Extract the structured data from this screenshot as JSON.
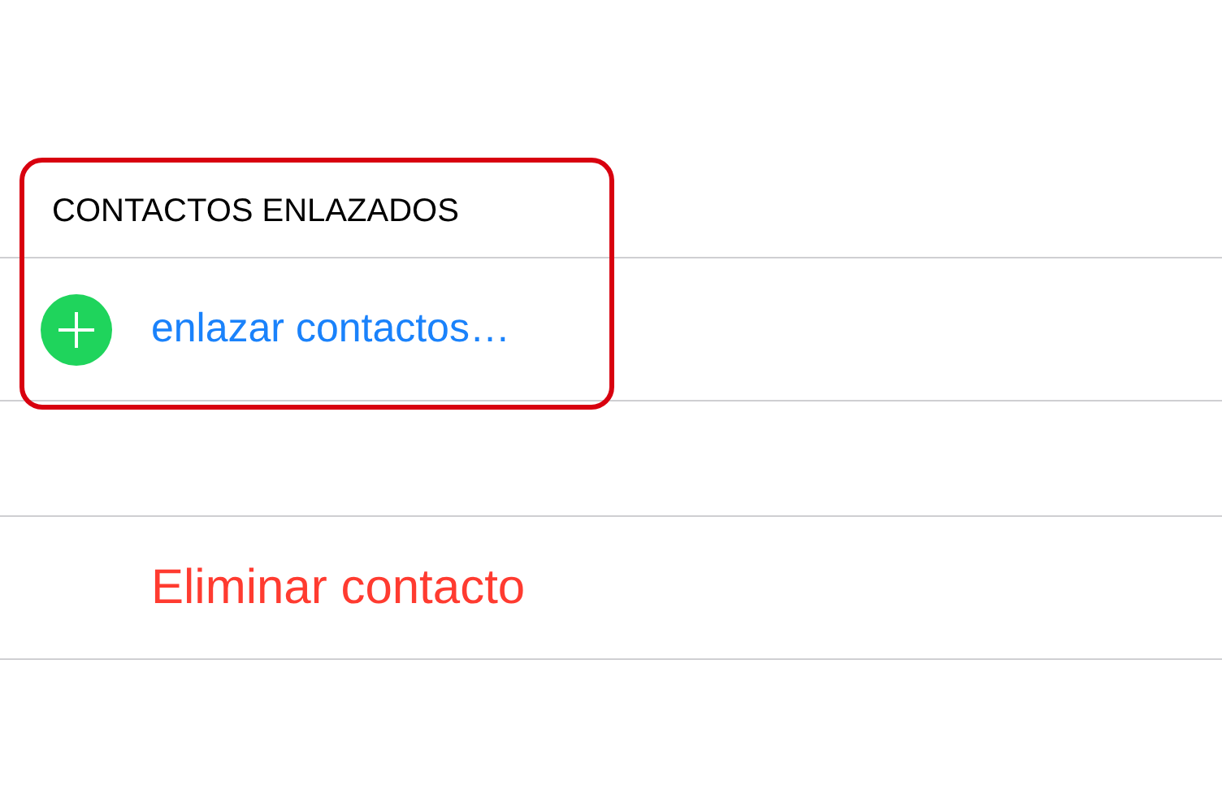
{
  "linked_contacts": {
    "header": "CONTACTOS ENLAZADOS",
    "highlighted": true,
    "add_row": {
      "label": "enlazar contactos…"
    }
  },
  "delete_button": {
    "label": "Eliminar contacto"
  }
}
